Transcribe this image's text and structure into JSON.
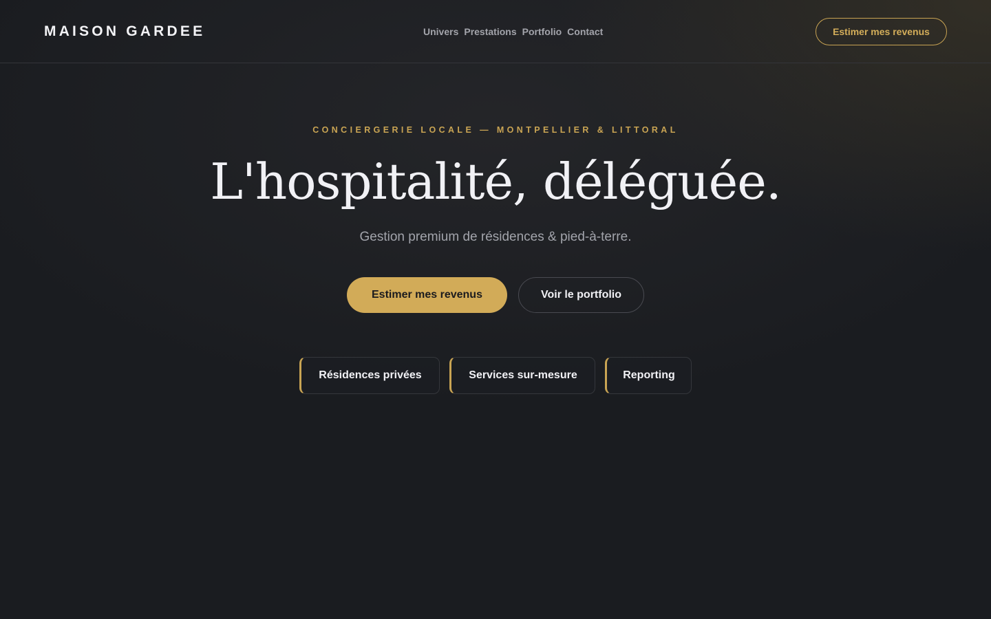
{
  "brand": {
    "name": "MAISON GARDEE"
  },
  "nav": {
    "items": [
      {
        "label": "Univers"
      },
      {
        "label": "Prestations"
      },
      {
        "label": "Portfolio"
      },
      {
        "label": "Contact"
      }
    ]
  },
  "header": {
    "cta_label": "Estimer mes revenus"
  },
  "hero": {
    "eyebrow": "CONCIERGERIE LOCALE — MONTPELLIER & LITTORAL",
    "title": "L'hospitalité, déléguée.",
    "subtitle": "Gestion premium de résidences & pied-à-terre.",
    "primary_cta": "Estimer mes revenus",
    "secondary_cta": "Voir le portfolio"
  },
  "features": [
    {
      "label": "Résidences privées"
    },
    {
      "label": "Services sur-mesure"
    },
    {
      "label": "Reporting"
    }
  ],
  "colors": {
    "accent": "#c9a453",
    "background": "#1a1c20",
    "text": "#f1f1f5",
    "muted": "#a3a4ab"
  }
}
